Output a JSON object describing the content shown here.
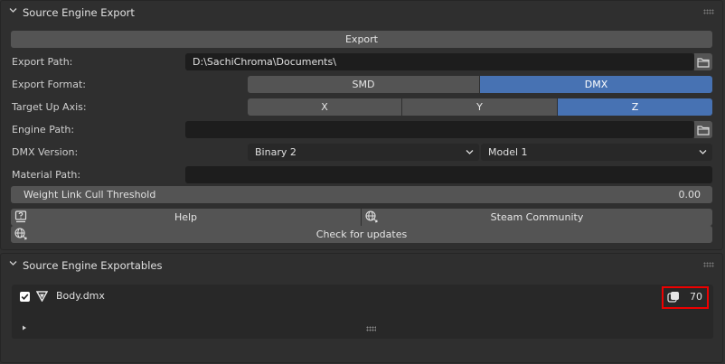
{
  "export_panel": {
    "title": "Source Engine Export",
    "export_button": "Export",
    "export_path": {
      "label": "Export Path:",
      "value": "D:\\SachiChroma\\Documents\\"
    },
    "export_format": {
      "label": "Export Format:",
      "options": [
        "SMD",
        "DMX"
      ],
      "selected": "DMX"
    },
    "up_axis": {
      "label": "Target Up Axis:",
      "options": [
        "X",
        "Y",
        "Z"
      ],
      "selected": "Z"
    },
    "engine_path": {
      "label": "Engine Path:",
      "value": ""
    },
    "dmx_version": {
      "label": "DMX Version:",
      "binary": "Binary 2",
      "model": "Model 1"
    },
    "material_path": {
      "label": "Material Path:",
      "value": ""
    },
    "weight_cull": {
      "label": "Weight Link Cull Threshold",
      "value": "0.00"
    },
    "help_button": "Help",
    "steam_button": "Steam Community",
    "updates_button": "Check for updates"
  },
  "exportables_panel": {
    "title": "Source Engine Exportables",
    "items": [
      {
        "name": "Body.dmx",
        "checked": true,
        "count": "70"
      }
    ]
  },
  "colors": {
    "accent": "#4772b3",
    "highlight": "#ee0000"
  }
}
